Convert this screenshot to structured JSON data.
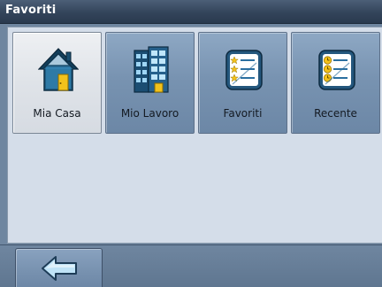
{
  "window": {
    "title": "Favoriti"
  },
  "tiles": [
    {
      "label": "Mia Casa",
      "icon": "home-icon",
      "selected": true
    },
    {
      "label": "Mio Lavoro",
      "icon": "office-building-icon",
      "selected": false
    },
    {
      "label": "Favoriti",
      "icon": "favorites-list-icon",
      "selected": false
    },
    {
      "label": "Recente",
      "icon": "recent-list-icon",
      "selected": false
    }
  ],
  "bottom_bar": {
    "back_icon": "back-arrow-icon"
  },
  "colors": {
    "title_bar": "#33445a",
    "panel_background": "#d4dde9",
    "tile_background": "#7893b1",
    "tile_selected_background": "#dfe3e8"
  }
}
